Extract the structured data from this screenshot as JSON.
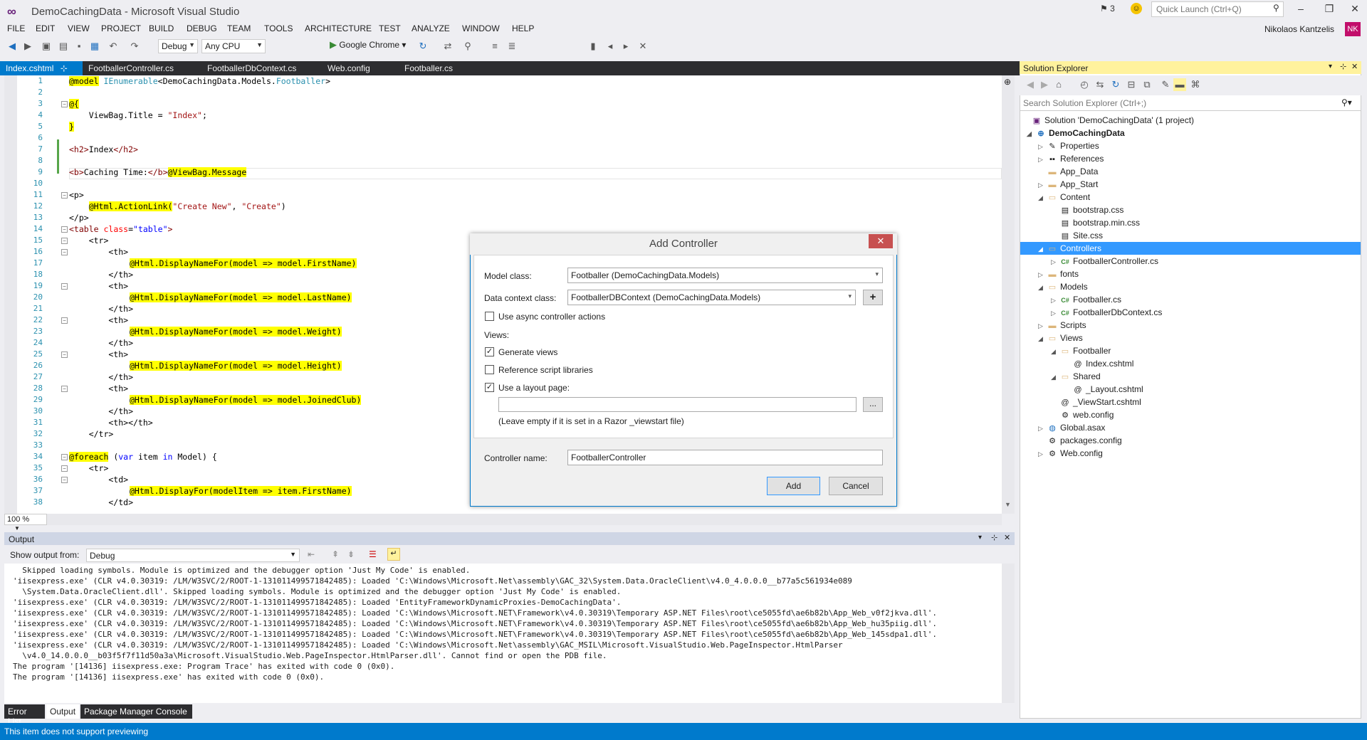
{
  "window": {
    "title": "DemoCachingData - Microsoft Visual Studio",
    "notifications": "3",
    "quick_launch_placeholder": "Quick Launch (Ctrl+Q)",
    "user_name": "Nikolaos Kantzelis",
    "user_initials": "NK"
  },
  "menu": [
    "FILE",
    "EDIT",
    "VIEW",
    "PROJECT",
    "BUILD",
    "DEBUG",
    "TEAM",
    "TOOLS",
    "ARCHITECTURE",
    "TEST",
    "ANALYZE",
    "WINDOW",
    "HELP"
  ],
  "toolbar": {
    "config": "Debug",
    "platform": "Any CPU",
    "run_target": "Google Chrome"
  },
  "doc_tabs": [
    "Index.cshtml",
    "FootballerController.cs",
    "FootballerDbContext.cs",
    "Web.config",
    "Footballer.cs"
  ],
  "editor": {
    "zoom": "100 %",
    "line_numbers": [
      "1",
      "2",
      "3",
      "4",
      "5",
      "6",
      "7",
      "8",
      "9",
      "10",
      "11",
      "12",
      "13",
      "14",
      "15",
      "16",
      "17",
      "18",
      "19",
      "20",
      "21",
      "22",
      "23",
      "24",
      "25",
      "26",
      "27",
      "28",
      "29",
      "30",
      "31",
      "32",
      "33",
      "34",
      "35",
      "36",
      "37",
      "38"
    ],
    "lines": {
      "l1_a": "@model",
      "l1_b": " IEnumerable",
      "l1_c": "<DemoCachingData.Models.",
      "l1_d": "Footballer",
      "l1_e": ">",
      "l3": "@{",
      "l4_a": "    ViewBag.Title = ",
      "l4_b": "\"Index\"",
      "l4_c": ";",
      "l5": "}",
      "l7_a": "<h2>",
      "l7_b": "Index",
      "l7_c": "</h2>",
      "l9_a": "<b>",
      "l9_b": "Caching Time:",
      "l9_c": "</b>",
      "l9_d": "@ViewBag.Message",
      "l11": "<p>",
      "l12_a": "    ",
      "l12_b": "@Html.ActionLink(",
      "l12_c": "\"Create New\"",
      "l12_d": ", ",
      "l12_e": "\"Create\"",
      "l12_f": ")",
      "l13": "</p>",
      "l14_a": "<table ",
      "l14_b": "class",
      "l14_c": "=",
      "l14_d": "\"table\"",
      "l14_e": ">",
      "l15": "    <tr>",
      "l16": "        <th>",
      "l17": "@Html.DisplayNameFor(model => model.FirstName)",
      "l18": "        </th>",
      "l19": "        <th>",
      "l20": "@Html.DisplayNameFor(model => model.LastName)",
      "l21": "        </th>",
      "l22": "        <th>",
      "l23": "@Html.DisplayNameFor(model => model.Weight)",
      "l24": "        </th>",
      "l25": "        <th>",
      "l26": "@Html.DisplayNameFor(model => model.Height)",
      "l27": "        </th>",
      "l28": "        <th>",
      "l29": "@Html.DisplayNameFor(model => model.JoinedClub)",
      "l30": "        </th>",
      "l31": "        <th></th>",
      "l32": "    </tr>",
      "l34_a": "@foreach",
      "l34_b": " (",
      "l34_c": "var",
      "l34_d": " item ",
      "l34_e": "in",
      "l34_f": " Model) {",
      "l35": "    <tr>",
      "l36": "        <td>",
      "l37": "@Html.DisplayFor(modelItem => item.FirstName)",
      "l38": "        </td>"
    }
  },
  "output": {
    "title": "Output",
    "show_from_label": "Show output from:",
    "show_from_value": "Debug",
    "lines": [
      "  Skipped loading symbols. Module is optimized and the debugger option 'Just My Code' is enabled.",
      "'iisexpress.exe' (CLR v4.0.30319: /LM/W3SVC/2/ROOT-1-131011499571842485): Loaded 'C:\\Windows\\Microsoft.Net\\assembly\\GAC_32\\System.Data.OracleClient\\v4.0_4.0.0.0__b77a5c561934e089",
      "  \\System.Data.OracleClient.dll'. Skipped loading symbols. Module is optimized and the debugger option 'Just My Code' is enabled.",
      "'iisexpress.exe' (CLR v4.0.30319: /LM/W3SVC/2/ROOT-1-131011499571842485): Loaded 'EntityFrameworkDynamicProxies-DemoCachingData'.",
      "'iisexpress.exe' (CLR v4.0.30319: /LM/W3SVC/2/ROOT-1-131011499571842485): Loaded 'C:\\Windows\\Microsoft.NET\\Framework\\v4.0.30319\\Temporary ASP.NET Files\\root\\ce5055fd\\ae6b82b\\App_Web_v0f2jkva.dll'.",
      "'iisexpress.exe' (CLR v4.0.30319: /LM/W3SVC/2/ROOT-1-131011499571842485): Loaded 'C:\\Windows\\Microsoft.NET\\Framework\\v4.0.30319\\Temporary ASP.NET Files\\root\\ce5055fd\\ae6b82b\\App_Web_hu35piig.dll'.",
      "'iisexpress.exe' (CLR v4.0.30319: /LM/W3SVC/2/ROOT-1-131011499571842485): Loaded 'C:\\Windows\\Microsoft.NET\\Framework\\v4.0.30319\\Temporary ASP.NET Files\\root\\ce5055fd\\ae6b82b\\App_Web_145sdpa1.dll'.",
      "'iisexpress.exe' (CLR v4.0.30319: /LM/W3SVC/2/ROOT-1-131011499571842485): Loaded 'C:\\Windows\\Microsoft.Net\\assembly\\GAC_MSIL\\Microsoft.VisualStudio.Web.PageInspector.HtmlParser",
      "  \\v4.0_14.0.0.0__b03f5f7f11d50a3a\\Microsoft.VisualStudio.Web.PageInspector.HtmlParser.dll'. Cannot find or open the PDB file.",
      "The program '[14136] iisexpress.exe: Program Trace' has exited with code 0 (0x0).",
      "The program '[14136] iisexpress.exe' has exited with code 0 (0x0)."
    ]
  },
  "bottom_tabs": [
    "Error List",
    "Output",
    "Package Manager Console"
  ],
  "status": "This item does not support previewing",
  "solution_explorer": {
    "title": "Solution Explorer",
    "search_placeholder": "Search Solution Explorer (Ctrl+;)",
    "nodes": [
      "Solution 'DemoCachingData' (1 project)",
      "DemoCachingData",
      "Properties",
      "References",
      "App_Data",
      "App_Start",
      "Content",
      "bootstrap.css",
      "bootstrap.min.css",
      "Site.css",
      "Controllers",
      "FootballerController.cs",
      "fonts",
      "Models",
      "Footballer.cs",
      "FootballerDbContext.cs",
      "Scripts",
      "Views",
      "Footballer",
      "Index.cshtml",
      "Shared",
      "_Layout.cshtml",
      "_ViewStart.cshtml",
      "web.config",
      "Global.asax",
      "packages.config",
      "Web.config"
    ]
  },
  "dialog": {
    "title": "Add Controller",
    "model_class_label": "Model class:",
    "model_class_value": "Footballer (DemoCachingData.Models)",
    "data_context_label": "Data context class:",
    "data_context_value": "FootballerDBContext (DemoCachingData.Models)",
    "async_label": "Use async controller actions",
    "views_label": "Views:",
    "generate_views_label": "Generate views",
    "ref_scripts_label": "Reference script libraries",
    "layout_label": "Use a layout page:",
    "layout_value": "",
    "layout_hint": "(Leave empty if it is set in a Razor _viewstart file)",
    "controller_name_label": "Controller name:",
    "controller_name_value": "FootballerController",
    "add_label": "Add",
    "cancel_label": "Cancel",
    "browse_label": "...",
    "plus_label": "+",
    "close_label": "✕",
    "async_checked": false,
    "generate_views_checked": true,
    "ref_scripts_checked": false,
    "layout_checked": true
  }
}
